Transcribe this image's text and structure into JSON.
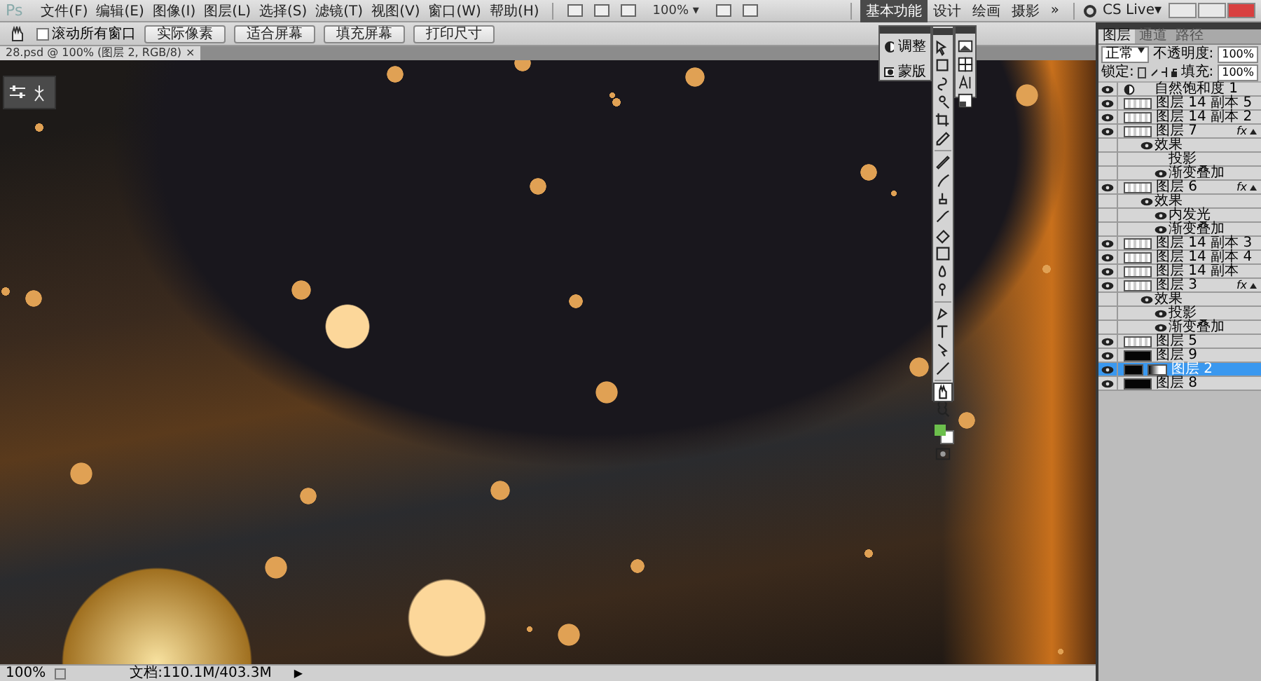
{
  "app": {
    "logo": "Ps"
  },
  "menu": [
    "文件(F)",
    "编辑(E)",
    "图像(I)",
    "图层(L)",
    "选择(S)",
    "滤镜(T)",
    "视图(V)",
    "窗口(W)",
    "帮助(H)"
  ],
  "app_bar": {
    "zoom": "100%",
    "zoom_caret": "▾"
  },
  "workspaces": [
    {
      "label": "基本功能",
      "selected": true
    },
    {
      "label": "设计",
      "selected": false
    },
    {
      "label": "绘画",
      "selected": false
    },
    {
      "label": "摄影",
      "selected": false
    }
  ],
  "more": "»",
  "cs_live": "CS Live▾",
  "options": {
    "scroll_all": {
      "label": "滚动所有窗口",
      "checked": false
    },
    "buttons": [
      "实际像素",
      "适合屏幕",
      "填充屏幕",
      "打印尺寸"
    ]
  },
  "document": {
    "tab": "28.psd @ 100% (图层 2, RGB/8)",
    "close": "×"
  },
  "adjust_panel": [
    "调整",
    "蒙版"
  ],
  "tools": [
    {
      "selected": false
    },
    {
      "selected": false
    },
    {
      "selected": false
    },
    {
      "selected": false
    },
    {
      "selected": false
    },
    {
      "selected": false
    },
    {
      "selected": false
    },
    {
      "selected": false
    },
    {
      "selected": false
    },
    {
      "selected": false
    },
    {
      "selected": false
    },
    {
      "selected": false
    },
    {
      "selected": false
    },
    {
      "selected": false
    },
    {
      "selected": false
    },
    {
      "selected": false
    },
    {
      "selected": false
    },
    {
      "selected": false
    },
    {
      "selected": true
    },
    {
      "selected": false
    }
  ],
  "layers_panel": {
    "tabs": [
      {
        "label": "图层",
        "selected": true
      },
      {
        "label": "通道",
        "selected": false
      },
      {
        "label": "路径",
        "selected": false
      }
    ],
    "blend_mode": "正常",
    "opacity_label": "不透明度:",
    "opacity": "100%",
    "lock_label": "锁定:",
    "fill_label": "填充:",
    "fill": "100%",
    "layers": [
      {
        "name": "自然饱和度 1",
        "kind": "adjustment",
        "visible": true,
        "selected": false
      },
      {
        "name": "图层 14 副本 5",
        "kind": "layer",
        "visible": true,
        "selected": false
      },
      {
        "name": "图层 14 副本 2",
        "kind": "layer",
        "visible": true,
        "selected": false
      },
      {
        "name": "图层 7",
        "kind": "layer",
        "visible": true,
        "selected": false,
        "badge": "fx",
        "expanded": true,
        "children": [
          {
            "name": "效果",
            "kind": "effects",
            "visible": true,
            "children": [
              {
                "name": "投影",
                "kind": "effect",
                "visible": false
              },
              {
                "name": "渐变叠加",
                "kind": "effect",
                "visible": true
              }
            ]
          }
        ]
      },
      {
        "name": "图层 6",
        "kind": "layer",
        "visible": true,
        "selected": false,
        "badge": "fx",
        "expanded": true,
        "children": [
          {
            "name": "效果",
            "kind": "effects",
            "visible": true,
            "children": [
              {
                "name": "内发光",
                "kind": "effect",
                "visible": true
              },
              {
                "name": "渐变叠加",
                "kind": "effect",
                "visible": true
              }
            ]
          }
        ]
      },
      {
        "name": "图层 14 副本 3",
        "kind": "layer",
        "visible": true,
        "selected": false
      },
      {
        "name": "图层 14 副本 4",
        "kind": "layer",
        "visible": true,
        "selected": false
      },
      {
        "name": "图层 14 副本",
        "kind": "layer",
        "visible": true,
        "selected": false
      },
      {
        "name": "图层 3",
        "kind": "layer",
        "visible": true,
        "selected": false,
        "badge": "fx",
        "expanded": true,
        "children": [
          {
            "name": "效果",
            "kind": "effects",
            "visible": true,
            "children": [
              {
                "name": "投影",
                "kind": "effect",
                "visible": true
              },
              {
                "name": "渐变叠加",
                "kind": "effect",
                "visible": true
              }
            ]
          }
        ]
      },
      {
        "name": "图层 5",
        "kind": "layer",
        "visible": true,
        "selected": false
      },
      {
        "name": "图层 9",
        "kind": "dark-layer",
        "visible": true,
        "selected": false
      },
      {
        "name": "图层 2",
        "kind": "masked-layer",
        "visible": true,
        "selected": true
      },
      {
        "name": "图层 8",
        "kind": "dark-layer",
        "visible": true,
        "selected": false
      }
    ]
  },
  "status": {
    "zoom": "100%",
    "doc": "文档:110.1M/403.3M",
    "arrow": "▶"
  }
}
